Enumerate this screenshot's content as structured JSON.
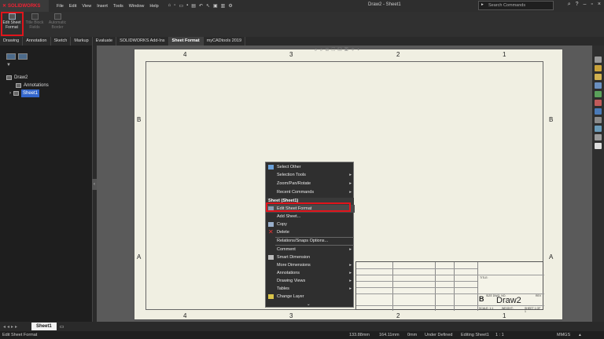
{
  "app": {
    "logo_text": "SOLIDWORKS",
    "doc_title": "Draw2 - Sheet1"
  },
  "menu": [
    "File",
    "Edit",
    "View",
    "Insert",
    "Tools",
    "Window",
    "Help"
  ],
  "search": {
    "placeholder": "Search Commands"
  },
  "ribbon": {
    "edit_sheet_format": "Edit Sheet Format",
    "title_block_fields": "Title Block Fields",
    "automatic_border": "Automatic Border"
  },
  "tabs": [
    "Drawing",
    "Annotation",
    "Sketch",
    "Markup",
    "Evaluate",
    "SOLIDWORKS Add-Ins",
    "Sheet Format",
    "myCADtools 2019"
  ],
  "tree": {
    "root": "Draw2",
    "annotations": "Annotations",
    "sheet": "Sheet1"
  },
  "zones": {
    "top": [
      "4",
      "3",
      "2",
      "1"
    ],
    "bottom": [
      "4",
      "3",
      "2",
      "1"
    ],
    "left": [
      "B",
      "A"
    ],
    "right": [
      "B",
      "A"
    ]
  },
  "titleblock": {
    "size": "B",
    "dwg_label": "SIZE DWG. NO.",
    "dwg_no": "Draw2",
    "rev": "REV",
    "title": "TITLE:",
    "scale": "SCALE: 1:1",
    "weight": "WEIGHT:",
    "sheet": "SHEET 1 OF 1"
  },
  "context_menu": {
    "items": [
      {
        "label": "Select Other",
        "arrow": ""
      },
      {
        "label": "Selection Tools",
        "arrow": "▸"
      },
      {
        "label": "Zoom/Pan/Rotate",
        "arrow": "▸"
      },
      {
        "label": "Recent Commands",
        "arrow": "▸"
      }
    ],
    "header": "Sheet (Sheet1)",
    "items2": [
      {
        "label": "Edit Sheet Format",
        "arrow": ""
      },
      {
        "label": "Add Sheet...",
        "arrow": ""
      },
      {
        "label": "Copy",
        "arrow": ""
      },
      {
        "label": "Delete",
        "arrow": ""
      },
      {
        "label": "Relations/Snaps Options...",
        "arrow": ""
      },
      {
        "label": "Comment",
        "arrow": "▸"
      },
      {
        "label": "Smart Dimension",
        "arrow": ""
      },
      {
        "label": "More Dimensions",
        "arrow": "▸"
      },
      {
        "label": "Annotations",
        "arrow": "▸"
      },
      {
        "label": "Drawing Views",
        "arrow": "▸"
      },
      {
        "label": "Tables",
        "arrow": "▸"
      },
      {
        "label": "Change Layer",
        "arrow": ""
      }
    ],
    "more": "⌄"
  },
  "sheet_tab": "Sheet1",
  "status": {
    "left": "Edit Sheet Format",
    "x": "133.88mm",
    "y": "164.11mm",
    "z": "0mm",
    "state": "Under Defined",
    "editing": "Editing Sheet1",
    "scale": "1 : 1",
    "units": "MMGS"
  },
  "colors": {
    "highlight": "#e1141b",
    "accent": "#3366cc"
  }
}
